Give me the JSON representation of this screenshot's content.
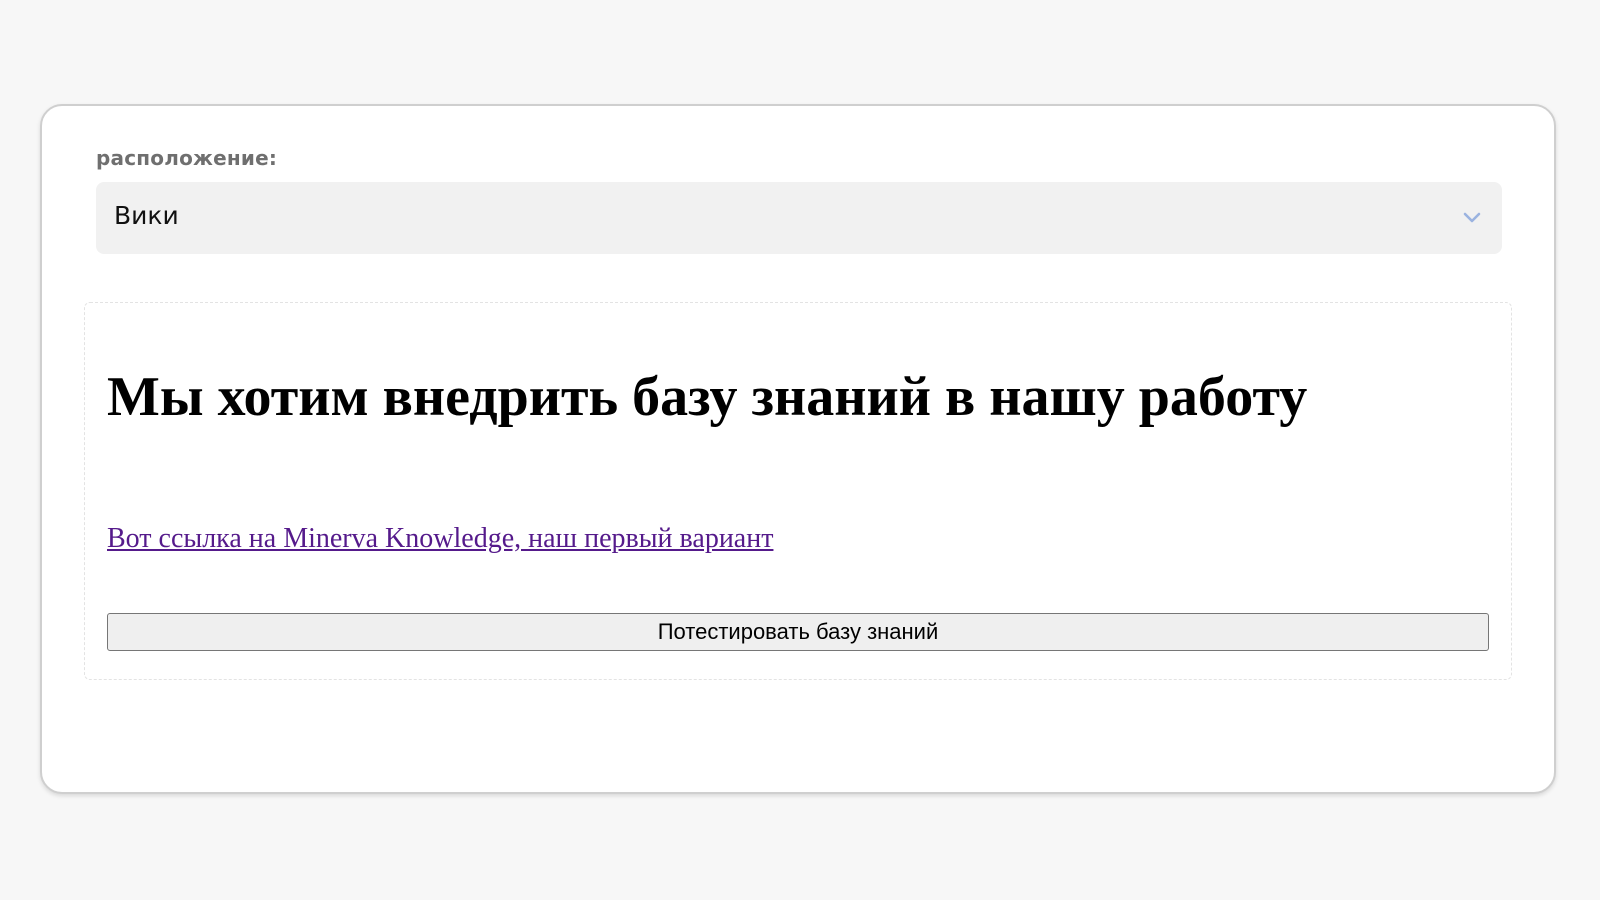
{
  "form": {
    "location_label": "расположение:",
    "location_selected": "Вики",
    "chevron_icon": "chevron-down-icon",
    "chevron_color": "#9bb3e0"
  },
  "content": {
    "heading": "Мы хотим внедрить базу знаний в нашу работу",
    "link_text": "Вот ссылка на Minerva Knowledge, наш первый вариант",
    "button_label": "Потестировать базу знаний"
  },
  "colors": {
    "page_background": "#f7f7f7",
    "select_background": "#f1f1f1",
    "link": "#551a8b"
  }
}
